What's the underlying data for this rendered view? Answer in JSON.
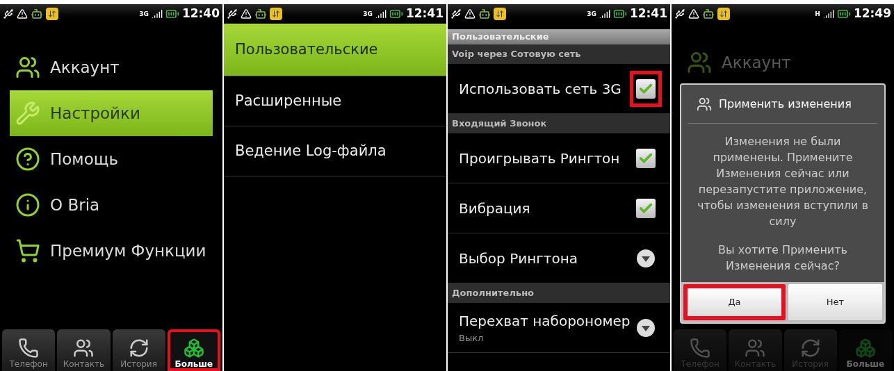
{
  "screens": [
    {
      "kind": "main_menu",
      "status_bar": {
        "network": "3G",
        "time": "12:40"
      },
      "menu": [
        {
          "label": "Аккаунт",
          "selected": false
        },
        {
          "label": "Настройки",
          "selected": true
        },
        {
          "label": "Помощь",
          "selected": false
        },
        {
          "label": "O Bria",
          "selected": false
        },
        {
          "label": "Премиум Функции",
          "selected": false
        }
      ],
      "tabs": [
        {
          "label": "Телефон",
          "selected": false,
          "highlighted": false
        },
        {
          "label": "Контакть",
          "selected": false,
          "highlighted": false
        },
        {
          "label": "История",
          "selected": false,
          "highlighted": false
        },
        {
          "label": "Больше",
          "selected": true,
          "highlighted": true
        }
      ]
    },
    {
      "kind": "settings_list",
      "status_bar": {
        "network": "3G",
        "time": "12:41"
      },
      "items": [
        {
          "label": "Пользовательские",
          "selected": true
        },
        {
          "label": "Расширенные",
          "selected": false
        },
        {
          "label": "Ведение Log-файла",
          "selected": false
        }
      ]
    },
    {
      "kind": "preferences",
      "status_bar": {
        "network": "3G",
        "time": "12:41"
      },
      "title": "Пользовательские",
      "rows": [
        {
          "kind": "header",
          "label": "Voip через Сотовую сеть"
        },
        {
          "kind": "checkbox",
          "label": "Использовать сеть 3G",
          "checked": true,
          "highlighted": true
        },
        {
          "kind": "header",
          "label": "Входящий Звонок"
        },
        {
          "kind": "checkbox",
          "label": "Проигрывать Рингтон",
          "checked": true,
          "highlighted": false
        },
        {
          "kind": "checkbox",
          "label": "Вибрация",
          "checked": true,
          "highlighted": false
        },
        {
          "kind": "dropdown",
          "label": "Выбор Рингтона"
        },
        {
          "kind": "header",
          "label": "Дополнительно"
        },
        {
          "kind": "dropdown",
          "label": "Перехват наборономер",
          "summary": "Выкл"
        }
      ]
    },
    {
      "kind": "dialog_over_menu",
      "status_bar": {
        "network": "H",
        "time": "12:49"
      },
      "menu": [
        {
          "label": "Аккаунт",
          "selected": false
        }
      ],
      "dialog": {
        "title": "Применить изменения",
        "message": "Изменения не были применены. Примените Изменения сейчас или перезапустите приложение, чтобы изменения вступили в силу",
        "question": "Вы хотите Применить Изменения сейчас?",
        "buttons": [
          {
            "label": "Да",
            "highlighted": true
          },
          {
            "label": "Нет",
            "highlighted": false
          }
        ]
      },
      "tabs": [
        {
          "label": "Телефон",
          "selected": false,
          "highlighted": false
        },
        {
          "label": "Контакть",
          "selected": false,
          "highlighted": false
        },
        {
          "label": "История",
          "selected": false,
          "highlighted": false
        },
        {
          "label": "Больше",
          "selected": true,
          "highlighted": false
        }
      ]
    }
  ]
}
